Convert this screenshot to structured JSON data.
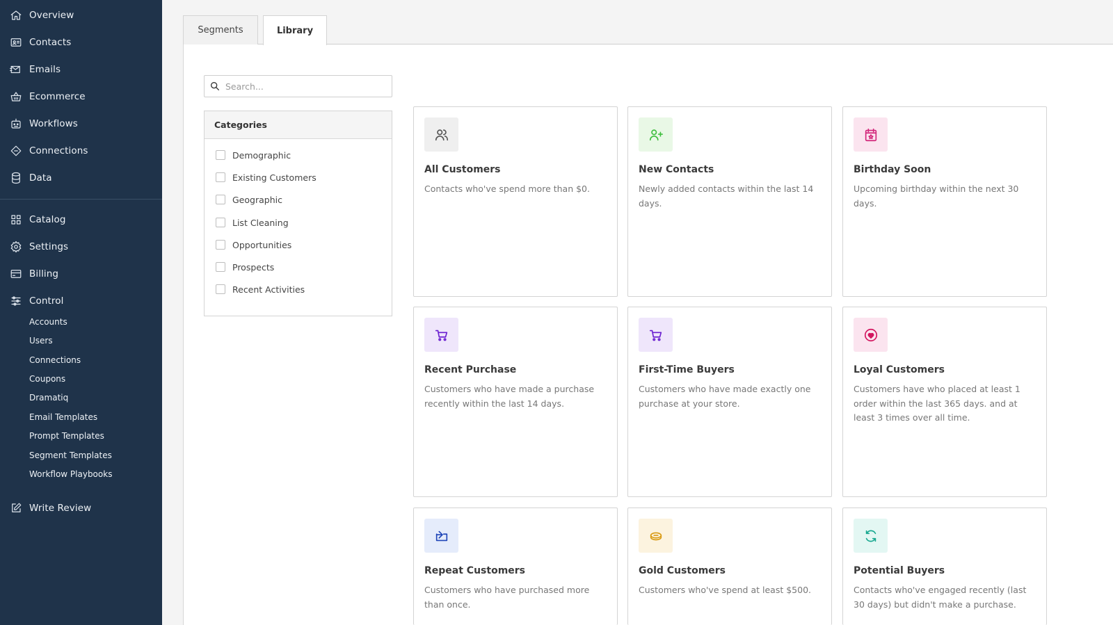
{
  "sidebar": {
    "nav": [
      {
        "label": "Overview",
        "icon": "home-icon"
      },
      {
        "label": "Contacts",
        "icon": "contact-card-icon"
      },
      {
        "label": "Emails",
        "icon": "mail-send-icon"
      },
      {
        "label": "Ecommerce",
        "icon": "basket-icon"
      },
      {
        "label": "Workflows",
        "icon": "robot-icon"
      },
      {
        "label": "Connections",
        "icon": "plug-icon"
      },
      {
        "label": "Data",
        "icon": "database-icon"
      }
    ],
    "nav2": [
      {
        "label": "Catalog",
        "icon": "grid-icon"
      },
      {
        "label": "Settings",
        "icon": "gear-icon"
      },
      {
        "label": "Billing",
        "icon": "credit-card-icon"
      },
      {
        "label": "Control",
        "icon": "sliders-icon"
      }
    ],
    "control_items": [
      "Accounts",
      "Users",
      "Connections",
      "Coupons",
      "Dramatiq",
      "Email Templates",
      "Prompt Templates",
      "Segment Templates",
      "Workflow Playbooks"
    ],
    "write_review": {
      "label": "Write Review",
      "icon": "edit-icon"
    }
  },
  "tabs": [
    {
      "label": "Segments",
      "active": false
    },
    {
      "label": "Library",
      "active": true
    }
  ],
  "search": {
    "placeholder": "Search...",
    "value": ""
  },
  "categories": {
    "heading": "Categories",
    "items": [
      "Demographic",
      "Existing Customers",
      "Geographic",
      "List Cleaning",
      "Opportunities",
      "Prospects",
      "Recent Activities"
    ]
  },
  "cards": [
    {
      "title": "All Customers",
      "desc": "Contacts who've spend more than $0.",
      "icon": "users-icon",
      "bg": "#efefef",
      "color": "#555555"
    },
    {
      "title": "New Contacts",
      "desc": "Newly added contacts within the last 14 days.",
      "icon": "user-plus-icon",
      "bg": "#e9f8e6",
      "color": "#3fbf3f"
    },
    {
      "title": "Birthday Soon",
      "desc": "Upcoming birthday within the next 30 days.",
      "icon": "calendar-star-icon",
      "bg": "#fbe4ef",
      "color": "#d2267a"
    },
    {
      "title": "Recent Purchase",
      "desc": "Customers who have made a purchase recently within the last 14 days.",
      "icon": "cart-icon",
      "bg": "#efe6fb",
      "color": "#6a1fd0"
    },
    {
      "title": "First-Time Buyers",
      "desc": "Customers who have made exactly one purchase at your store.",
      "icon": "cart-icon",
      "bg": "#efe6fb",
      "color": "#6a1fd0"
    },
    {
      "title": "Loyal Customers",
      "desc": "Customers have who placed at least 1 order within the last 365 days. and at least 3 times over all time.",
      "icon": "heart-circle-icon",
      "bg": "#fbe4ef",
      "color": "#d2165f"
    },
    {
      "title": "Repeat Customers",
      "desc": "Customers who have purchased more than once.",
      "icon": "repeat-icon",
      "bg": "#e5ecfb",
      "color": "#1f45b8"
    },
    {
      "title": "Gold Customers",
      "desc": "Customers who've spend at least $500.",
      "icon": "coin-icon",
      "bg": "#fcf3df",
      "color": "#d99a12"
    },
    {
      "title": "Potential Buyers",
      "desc": "Contacts who've engaged recently (last 30 days) but didn't make a purchase.",
      "icon": "refresh-icon",
      "bg": "#e3f7f3",
      "color": "#18a890"
    }
  ]
}
